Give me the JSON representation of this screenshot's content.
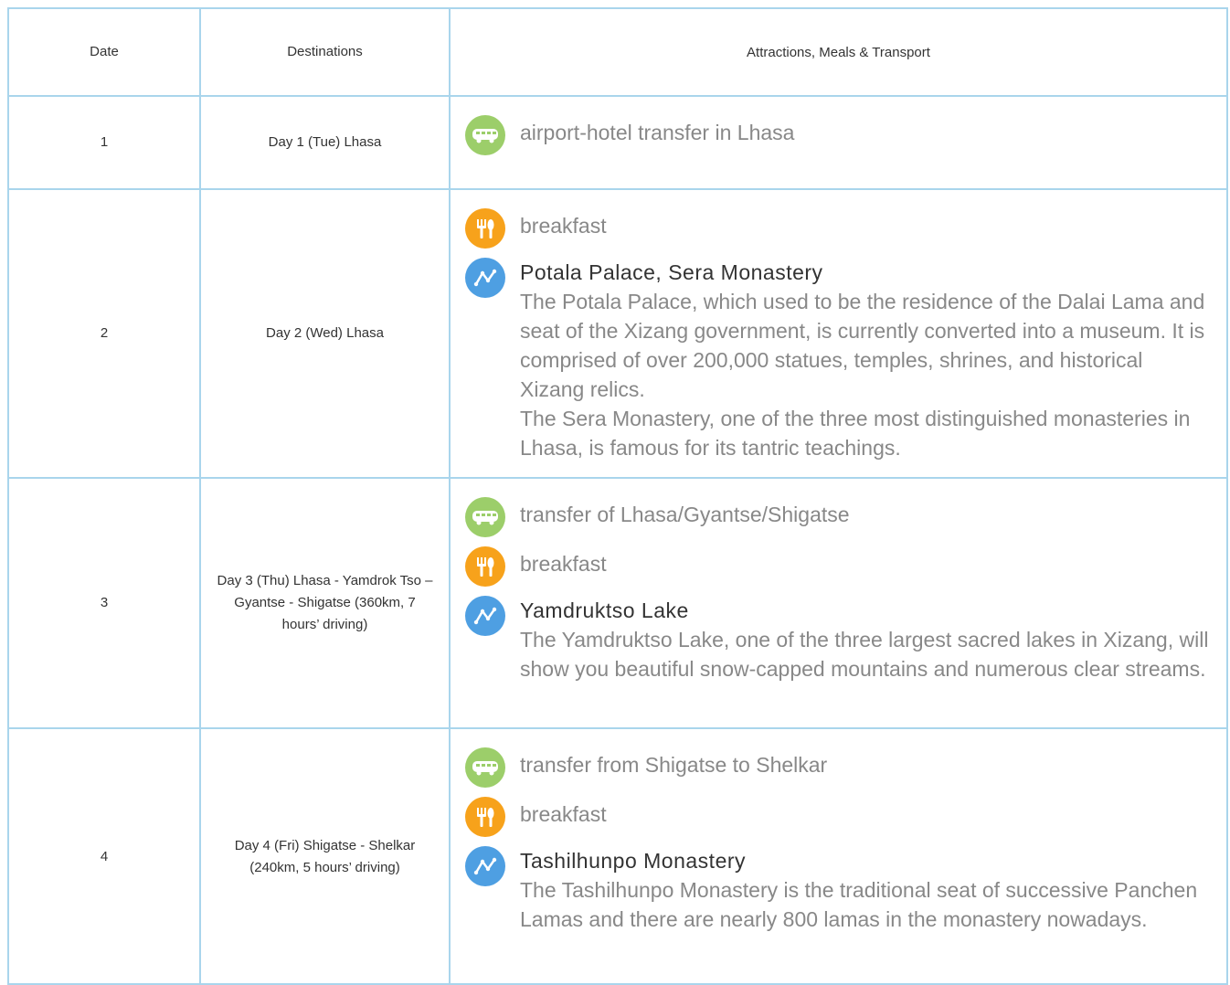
{
  "header": {
    "date": "Date",
    "destinations": "Destinations",
    "details": "Attractions, Meals & Transport"
  },
  "rows": [
    {
      "date": "1",
      "destination": "Day 1 (Tue) Lhasa",
      "items": [
        {
          "icon": "bus-icon",
          "text": "airport-hotel transfer in Lhasa"
        }
      ]
    },
    {
      "date": "2",
      "destination": "Day 2 (Wed) Lhasa",
      "items": [
        {
          "icon": "meal-icon",
          "text": "breakfast"
        },
        {
          "icon": "sightseeing-icon",
          "title": "Potala Palace, Sera Monastery",
          "desc": "The Potala Palace, which used to be the residence of the Dalai Lama and seat of the Xizang government, is currently converted into a museum. It is comprised of over 200,000 statues, temples, shrines, and historical Xizang relics.\nThe Sera Monastery, one of the three most distinguished monasteries in Lhasa, is famous for its tantric teachings."
        }
      ]
    },
    {
      "date": "3",
      "destination": "Day 3 (Thu) Lhasa - Yamdrok Tso – Gyantse - Shigatse (360km, 7 hours’ driving)",
      "items": [
        {
          "icon": "bus-icon",
          "text": "transfer of Lhasa/Gyantse/Shigatse"
        },
        {
          "icon": "meal-icon",
          "text": "breakfast"
        },
        {
          "icon": "sightseeing-icon",
          "title": "Yamdruktso Lake",
          "desc": "The Yamdruktso Lake, one of the three largest sacred lakes in Xizang, will show you beautiful snow-capped mountains and numerous clear streams."
        }
      ]
    },
    {
      "date": "4",
      "destination": "Day 4 (Fri) Shigatse - Shelkar (240km, 5 hours’ driving)",
      "items": [
        {
          "icon": "bus-icon",
          "text": "transfer from Shigatse to Shelkar"
        },
        {
          "icon": "meal-icon",
          "text": "breakfast"
        },
        {
          "icon": "sightseeing-icon",
          "title": "Tashilhunpo Monastery",
          "desc": "The Tashilhunpo Monastery is the traditional seat of successive Panchen Lamas and there are nearly 800 lamas in the monastery nowadays."
        }
      ]
    }
  ]
}
